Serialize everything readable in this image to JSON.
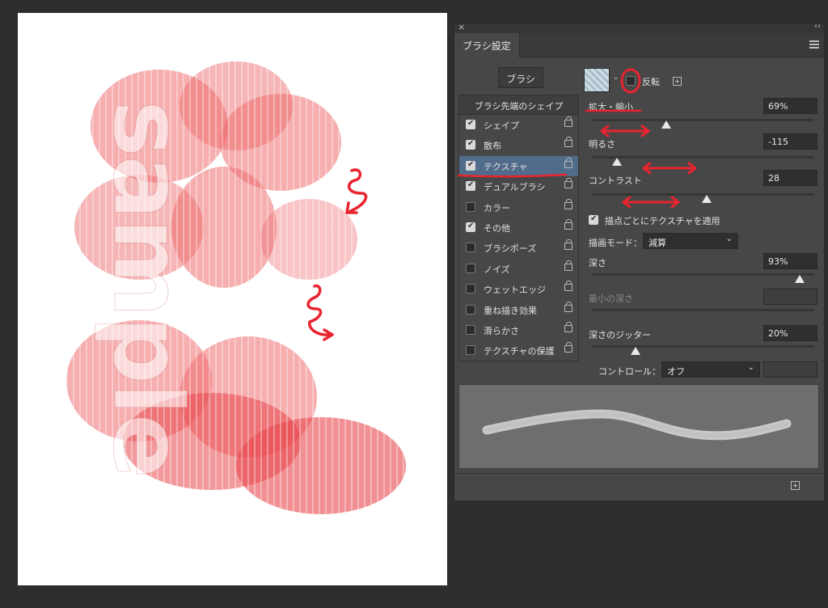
{
  "panel": {
    "tab_label": "ブラシ設定",
    "brush_button": "ブラシ",
    "invert_label": "反転"
  },
  "tip_list": {
    "header": "ブラシ先端のシェイプ",
    "items": [
      {
        "label": "シェイプ",
        "checked": true
      },
      {
        "label": "散布",
        "checked": true
      },
      {
        "label": "テクスチャ",
        "checked": true,
        "selected": true
      },
      {
        "label": "デュアルブラシ",
        "checked": true
      },
      {
        "label": "カラー",
        "checked": false
      },
      {
        "label": "その他",
        "checked": true
      },
      {
        "label": "ブラシポーズ",
        "checked": false
      },
      {
        "label": "ノイズ",
        "checked": false
      },
      {
        "label": "ウェットエッジ",
        "checked": false
      },
      {
        "label": "重ね描き効果",
        "checked": false
      },
      {
        "label": "滑らかさ",
        "checked": false
      },
      {
        "label": "テクスチャの保護",
        "checked": false
      }
    ]
  },
  "texture": {
    "scale_label": "拡大・縮小",
    "scale_value": "69%",
    "brightness_label": "明るさ",
    "brightness_value": "-115",
    "contrast_label": "コントラスト",
    "contrast_value": "28",
    "apply_each_tip_label": "描点ごとにテクスチャを適用",
    "mode_label": "描画モード：",
    "mode_value": "減算",
    "depth_label": "深さ",
    "depth_value": "93%",
    "min_depth_label": "最小の深さ",
    "depth_jitter_label": "深さのジッター",
    "depth_jitter_value": "20%",
    "control_label": "コントロール：",
    "control_value": "オフ"
  },
  "canvas": {
    "watermark_text": "sample"
  },
  "colors": {
    "annotation_red": "#e8242f",
    "paint_red": "#ee6b6e",
    "selection_blue": "#506c8a"
  }
}
